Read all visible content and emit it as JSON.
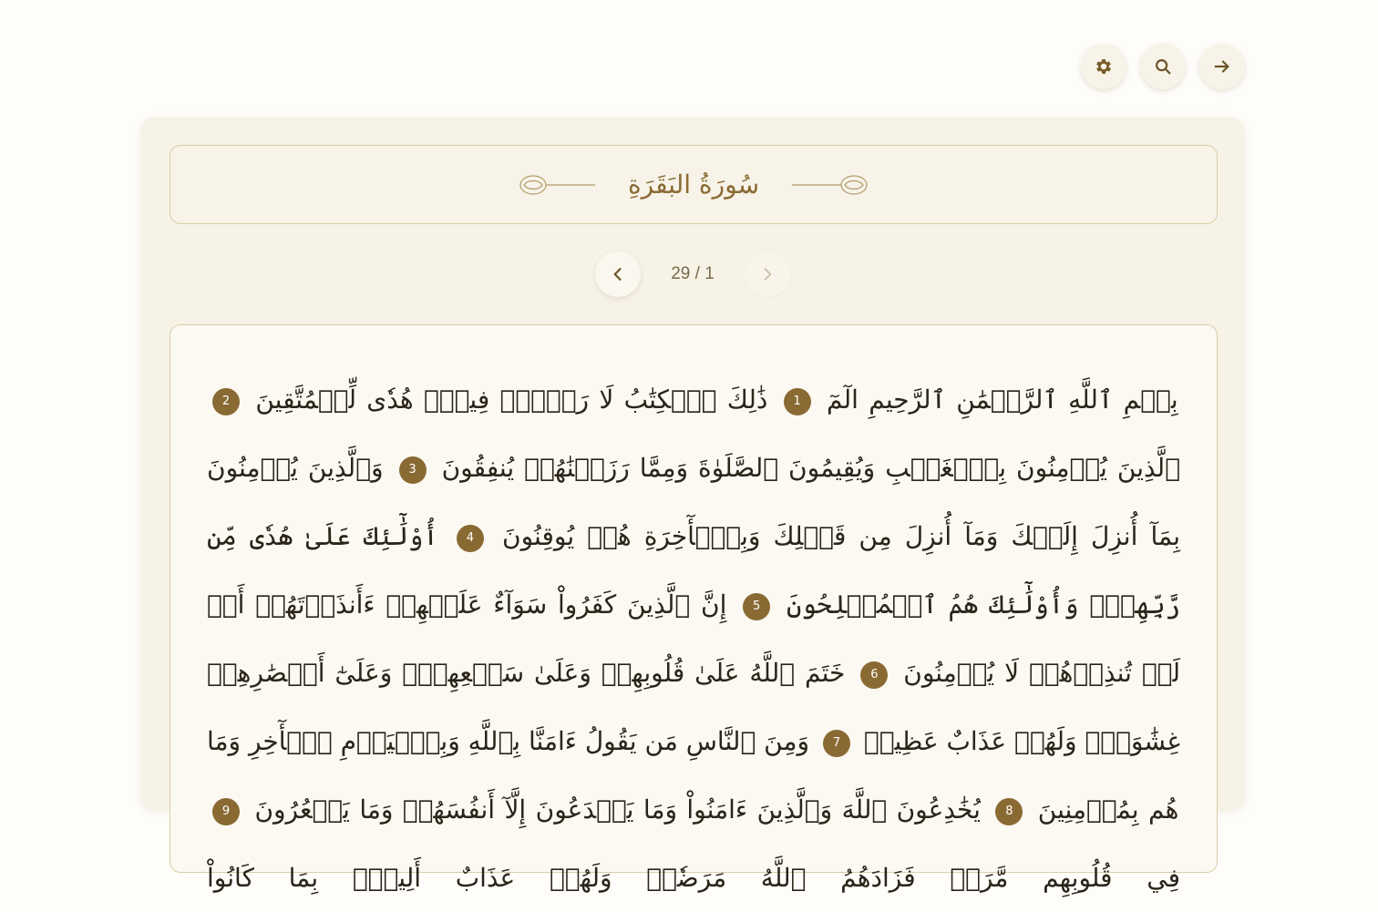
{
  "toolbar": {
    "buttons": [
      {
        "name": "back-button",
        "icon": "arrow-right-icon"
      },
      {
        "name": "search-button",
        "icon": "search-icon"
      },
      {
        "name": "settings-button",
        "icon": "gear-icon"
      }
    ]
  },
  "surah": {
    "title": "سُورَةُ البَقَرَةِ"
  },
  "pager": {
    "indicator": "29 / 1"
  },
  "colors": {
    "accent": "#8a6a33",
    "background": "#fefdfa",
    "panel": "#f6f2e6",
    "border": "#d9cda8"
  },
  "verses": [
    {
      "text": "بِسۡمِ ٱللَّهِ ٱلرَّحۡمَٰنِ ٱلرَّحِيمِ الٓمٓ",
      "number": "1"
    },
    {
      "text": "ذَٰلِكَ ٱلۡكِتَٰبُ لَا رَيۡبَۛ فِيهِۛ هُدٗى لِّلۡمُتَّقِينَ",
      "number": "2"
    },
    {
      "text": "ٱلَّذِينَ يُؤۡمِنُونَ بِٱلۡغَيۡبِ وَيُقِيمُونَ ٱلصَّلَوٰةَ وَمِمَّا رَزَقۡنَٰهُمۡ يُنفِقُونَ",
      "number": "3"
    },
    {
      "text": "وَٱلَّذِينَ يُؤۡمِنُونَ بِمَآ أُنزِلَ إِلَيۡكَ وَمَآ أُنزِلَ مِن قَبۡلِكَ وَبِٱلۡأٓخِرَةِ هُمۡ يُوقِنُونَ",
      "number": "4"
    },
    {
      "text": "أُوْلَٰٓئِكَ عَلَىٰ هُدٗى مِّن رَّبِّهِمۡۖ وَأُوْلَٰٓئِكَ هُمُ ٱلۡمُفۡلِحُونَ",
      "number": "5"
    },
    {
      "text": "إِنَّ ٱلَّذِينَ كَفَرُواْ سَوَآءٌ عَلَيۡهِمۡ ءَأَنذَرۡتَهُمۡ أَمۡ لَمۡ تُنذِرۡهُمۡ لَا يُؤۡمِنُونَ",
      "number": "6"
    },
    {
      "text": "خَتَمَ ٱللَّهُ عَلَىٰ قُلُوبِهِمۡ وَعَلَىٰ سَمۡعِهِمۡۖ وَعَلَىٰٓ أَبۡصَٰرِهِمۡ غِشَٰوَةٞۖ وَلَهُمۡ عَذَابٌ عَظِيمٞ",
      "number": "7"
    },
    {
      "text": "وَمِنَ ٱلنَّاسِ مَن يَقُولُ ءَامَنَّا بِٱللَّهِ وَبِٱلۡيَوۡمِ ٱلۡأٓخِرِ وَمَا هُم بِمُؤۡمِنِينَ",
      "number": "8"
    },
    {
      "text": "يُخَٰدِعُونَ ٱللَّهَ وَٱلَّذِينَ ءَامَنُواْ وَمَا يَخۡدَعُونَ إِلَّآ أَنفُسَهُمۡ وَمَا يَشۡعُرُونَ",
      "number": "9"
    },
    {
      "text": "فِي قُلُوبِهِم مَّرَضٞ فَزَادَهُمُ ٱللَّهُ مَرَضٗاۖ وَلَهُمۡ عَذَابٌ أَلِيمُۢ بِمَا كَانُواْ",
      "number": ""
    }
  ]
}
